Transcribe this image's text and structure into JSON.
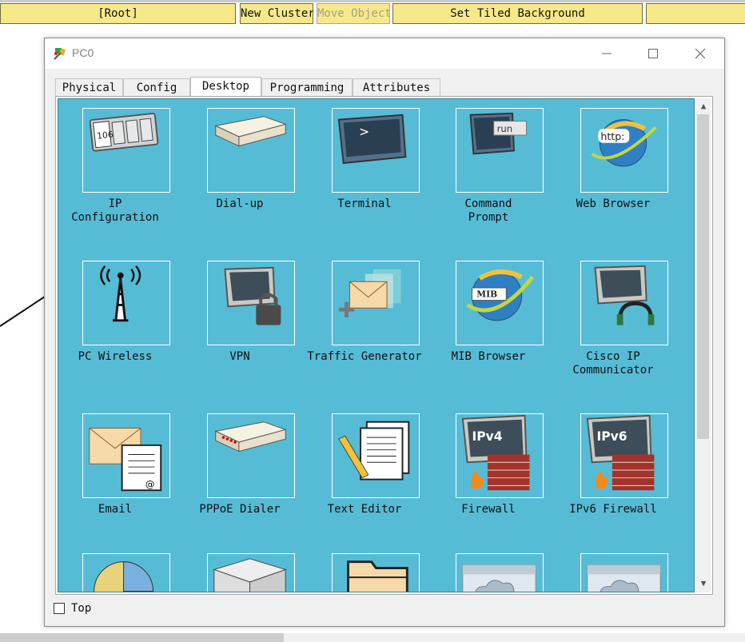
{
  "toolbar": {
    "root_label": "[Root]",
    "new_cluster_label": "New Cluster",
    "move_object_label": "Move Object",
    "tiled_bg_label": "Set Tiled Background"
  },
  "window": {
    "title": "PC0",
    "tabs": [
      "Physical",
      "Config",
      "Desktop",
      "Programming",
      "Attributes"
    ],
    "active_tab": "Desktop"
  },
  "apps": [
    {
      "label": "IP Configuration",
      "icon": "ip-configuration-icon",
      "text": "106"
    },
    {
      "label": "Dial-up",
      "icon": "modem-icon"
    },
    {
      "label": "Terminal",
      "icon": "terminal-icon",
      "text": ">"
    },
    {
      "label": "Command Prompt",
      "icon": "command-prompt-icon",
      "text": "run"
    },
    {
      "label": "Web Browser",
      "icon": "web-browser-icon",
      "text": "http:"
    },
    {
      "label": "PC Wireless",
      "icon": "wireless-antenna-icon"
    },
    {
      "label": "VPN",
      "icon": "vpn-lock-icon"
    },
    {
      "label": "Traffic Generator",
      "icon": "traffic-generator-icon"
    },
    {
      "label": "MIB Browser",
      "icon": "mib-browser-icon",
      "text": "MIB"
    },
    {
      "label": "Cisco IP Communicator",
      "icon": "ip-communicator-icon"
    },
    {
      "label": "Email",
      "icon": "email-icon"
    },
    {
      "label": "PPPoE Dialer",
      "icon": "pppoe-dialer-icon"
    },
    {
      "label": "Text Editor",
      "icon": "text-editor-icon"
    },
    {
      "label": "Firewall",
      "icon": "firewall-icon",
      "text": "IPv4"
    },
    {
      "label": "IPv6 Firewall",
      "icon": "ipv6-firewall-icon",
      "text": "IPv6"
    },
    {
      "label": "",
      "icon": "pie-chart-icon"
    },
    {
      "label": "",
      "icon": "package-box-icon"
    },
    {
      "label": "",
      "icon": "folder-icon"
    },
    {
      "label": "",
      "icon": "cloud-window-icon"
    },
    {
      "label": "",
      "icon": "cloud-window-icon"
    }
  ],
  "footer": {
    "top_checkbox_label": "Top",
    "top_checked": false
  },
  "colors": {
    "toolbar_button": "#f7e98a",
    "desktop_background": "#56bcd6"
  }
}
